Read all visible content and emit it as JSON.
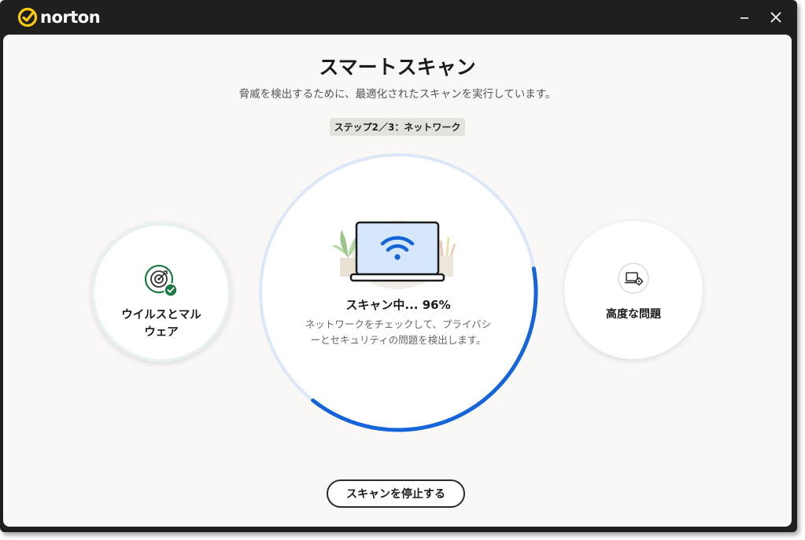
{
  "app": {
    "brand_name": "norton",
    "brand_color": "#fecc09"
  },
  "window_controls": {
    "minimize_icon": "minimize-icon",
    "close_icon": "close-icon"
  },
  "header": {
    "title": "スマートスキャン",
    "subtitle": "脅威を検出するために、最適化されたスキャンを実行しています。",
    "step": "ステップ2／3：ネットワーク"
  },
  "steps": {
    "left": {
      "label_line1": "ウイルスとマル",
      "label_line2": "ウェア",
      "icon": "target-check-icon",
      "status": "complete",
      "status_color": "#1e7a45"
    },
    "current": {
      "status_text": "スキャン中... 96%",
      "progress_percent": 96,
      "description": "ネットワークをチェックして、プライバシーとセキュリティの問題を検出します。",
      "icon": "laptop-wifi-icon",
      "progress_color": "#1565d8",
      "track_color": "#dce8f8"
    },
    "right": {
      "label": "高度な問題",
      "icon": "laptop-gear-icon"
    }
  },
  "actions": {
    "stop_label": "スキャンを停止する"
  }
}
